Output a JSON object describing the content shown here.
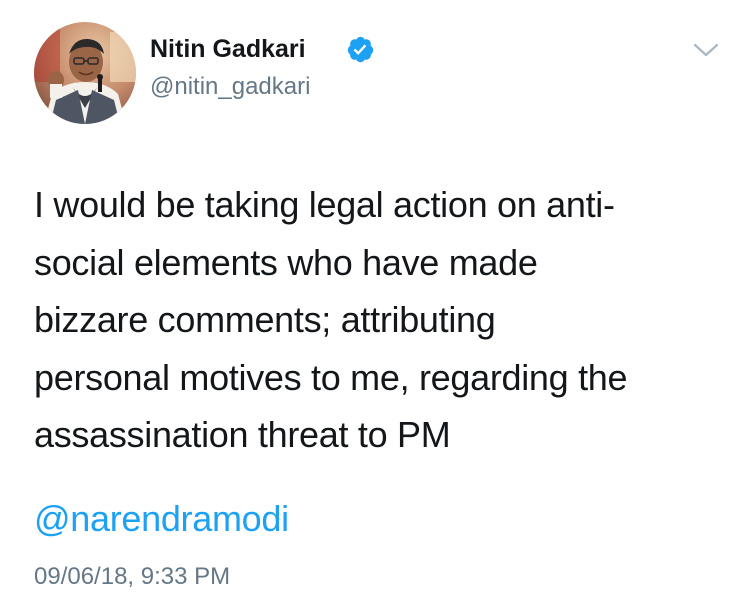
{
  "tweet": {
    "author": {
      "display_name": "Nitin Gadkari",
      "handle": "@nitin_gadkari",
      "verified": true,
      "avatar_icon": "profile-photo"
    },
    "text_lines": [
      "I would be taking legal action on anti-",
      "social elements who have made",
      "bizzare comments; attributing",
      "personal motives to me, regarding the",
      "assassination threat to PM"
    ],
    "mention": "@narendramodi",
    "timestamp": "09/06/18, 9:33 PM",
    "menu_icon": "chevron-down-icon"
  },
  "colors": {
    "text": "#14171a",
    "secondary": "#657786",
    "link": "#1da1f2",
    "verified": "#1da1f2",
    "chevron": "#aab8c2"
  }
}
